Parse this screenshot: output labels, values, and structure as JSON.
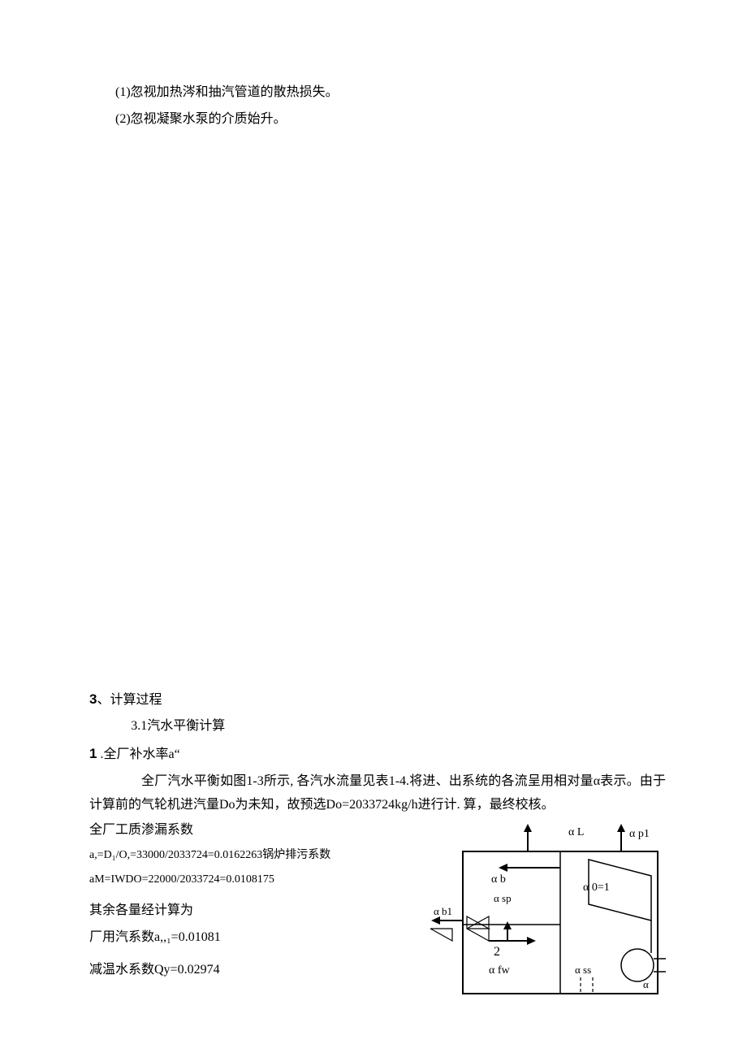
{
  "intro": {
    "line1": "(1)忽视加热涔和抽汽管道的散热损失。",
    "line2": "(2)忽视凝聚水泵的介质始升。"
  },
  "section3": {
    "heading_num": "3",
    "heading_sep": "、",
    "heading_text": "计算过程",
    "sub_3_1": "3.1汽水平衡计算"
  },
  "section1": {
    "num": "1",
    "sep": " .",
    "title": "全厂补水率a“",
    "p1": "全厂汽水平衡如图1-3所示, 各汽水流量见表1-4.将进、出系统的各流呈用相对量α表示。由于计算前的气轮机进汽量Do为未知，故预选Do=2033724kg/h进行计. 算，最终校核。",
    "line_coef_title": "全厂工质渗漏系数",
    "formula1": "a,=D₁/O,=33000/2033724=0.0162263锅炉排污系数",
    "formula2": "aM=IWDO=22000/2033724=0.0108175",
    "rest_title": "其余各量经计算为",
    "factory_steam": "厂用汽系数a,,₁=0.01081",
    "cooling": "减温水系数Qy=0.02974"
  },
  "diagram": {
    "alpha_L": "α L",
    "alpha_p1": "α p1",
    "alpha_b": "α b",
    "alpha_sp": "α sp",
    "alpha_b1": "α b1",
    "alpha_0_1": "α 0=1",
    "alpha_fw": "α fw",
    "alpha_ss": "α ss",
    "alpha_right": "α",
    "num2": "2"
  }
}
